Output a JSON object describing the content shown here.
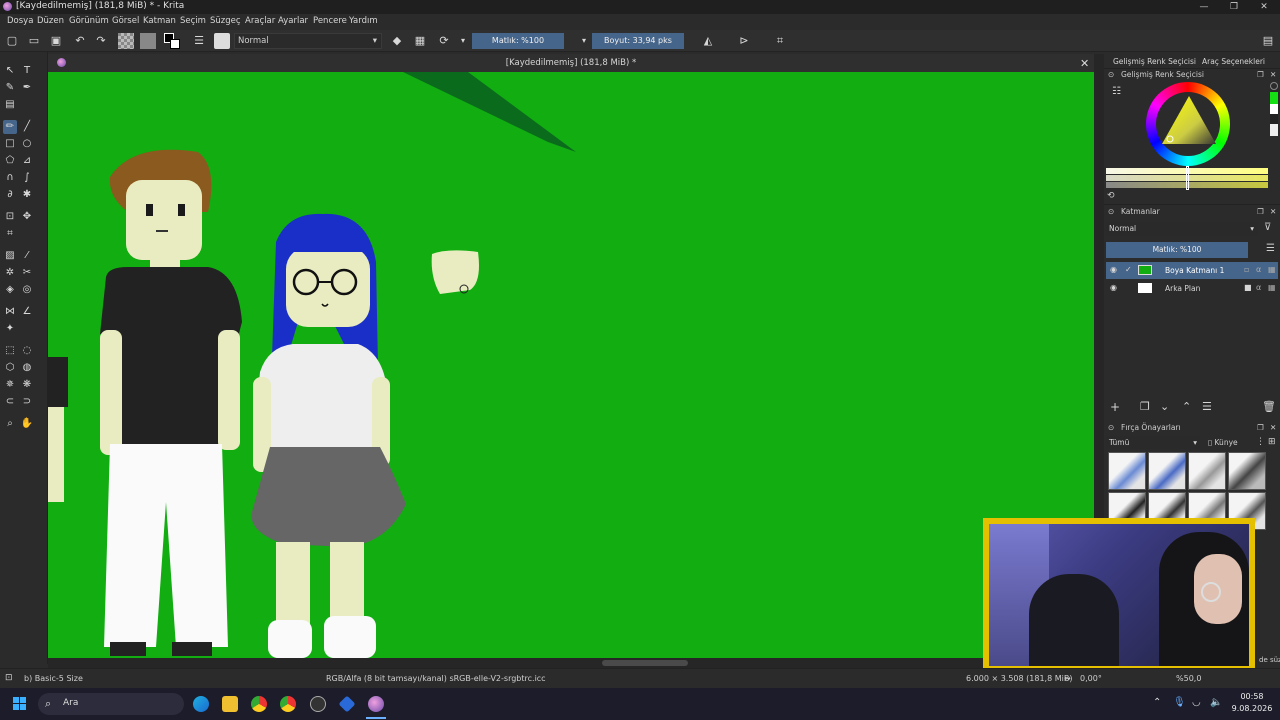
{
  "window": {
    "title": "[Kaydedilmemiş]  (181,8 MiB) * - Krita",
    "controls": [
      "—",
      "❐",
      "✕"
    ]
  },
  "menu": [
    "Dosya",
    "Düzen",
    "Görünüm",
    "Görsel",
    "Katman",
    "Seçim",
    "Süzgeç",
    "Araçlar",
    "Ayarlar",
    "Pencere",
    "Yardım"
  ],
  "toolbar": {
    "blend_mode": "Normal",
    "opacity": "Matlık: %100",
    "size": "Boyut: 33,94 pks"
  },
  "canvas": {
    "document_title": "[Kaydedilmemiş]  (181,8 MiB) *",
    "close": "✕"
  },
  "docker": {
    "tabs": [
      "Gelişmiş Renk Seçicisi",
      "Araç Seçenekleri"
    ],
    "color_selector_title": "Gelişmiş Renk Seçicisi",
    "layers_title": "Katmanlar",
    "layers_blend": "Normal",
    "layers_opacity": "Matlık: %100",
    "layers": [
      {
        "name": "Boya Katmanı 1",
        "selected": true
      },
      {
        "name": "Arka Plan",
        "selected": false
      }
    ],
    "brush_presets_title": "Fırça Önayarları",
    "brush_filter": "Tümü",
    "brush_tag": "Künye",
    "brush_search_suffix": "de süz"
  },
  "status": {
    "brush": "b) Basic-5 Size",
    "color_profile": "RGB/Alfa (8 bit tamsayı/kanal)  sRGB-elle-V2-srgbtrc.icc",
    "dimensions": "6.000 × 3.508 (181,8 MiB)",
    "rotation": "0,00°",
    "zoom": "%50,0"
  },
  "taskbar": {
    "search_placeholder": "Ara",
    "time": "00:58",
    "date": "9.08.2026"
  },
  "colors": {
    "canvas_green": "#11ad11",
    "accent": "#46658a"
  }
}
